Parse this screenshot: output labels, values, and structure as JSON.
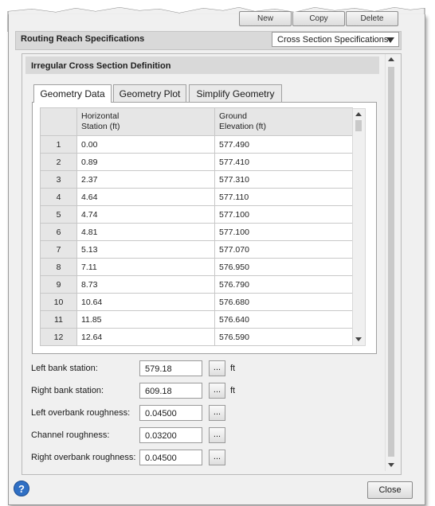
{
  "top_buttons": [
    "New",
    "Copy",
    "Delete"
  ],
  "reach": {
    "title": "Routing Reach Specifications",
    "dropdown_value": "Cross Section Specifications"
  },
  "section": {
    "title": "Irregular Cross Section Definition"
  },
  "tabs": [
    "Geometry Data",
    "Geometry Plot",
    "Simplify Geometry"
  ],
  "grid": {
    "col1": [
      "Horizontal",
      "Station (ft)"
    ],
    "col2": [
      "Ground",
      "Elevation (ft)"
    ],
    "rows": [
      {
        "n": "1",
        "station": "0.00",
        "elev": "577.490"
      },
      {
        "n": "2",
        "station": "0.89",
        "elev": "577.410"
      },
      {
        "n": "3",
        "station": "2.37",
        "elev": "577.310"
      },
      {
        "n": "4",
        "station": "4.64",
        "elev": "577.110"
      },
      {
        "n": "5",
        "station": "4.74",
        "elev": "577.100"
      },
      {
        "n": "6",
        "station": "4.81",
        "elev": "577.100"
      },
      {
        "n": "7",
        "station": "5.13",
        "elev": "577.070"
      },
      {
        "n": "8",
        "station": "7.11",
        "elev": "576.950"
      },
      {
        "n": "9",
        "station": "8.73",
        "elev": "576.790"
      },
      {
        "n": "10",
        "station": "10.64",
        "elev": "576.680"
      },
      {
        "n": "11",
        "station": "11.85",
        "elev": "576.640"
      },
      {
        "n": "12",
        "station": "12.64",
        "elev": "576.590"
      }
    ]
  },
  "fields": [
    {
      "label": "Left bank station:",
      "value": "579.18",
      "unit": "ft"
    },
    {
      "label": "Right bank station:",
      "value": "609.18",
      "unit": "ft"
    },
    {
      "label": "Left overbank roughness:",
      "value": "0.04500",
      "unit": ""
    },
    {
      "label": "Channel roughness:",
      "value": "0.03200",
      "unit": ""
    },
    {
      "label": "Right overbank roughness:",
      "value": "0.04500",
      "unit": ""
    }
  ],
  "ellipsis": "...",
  "help_glyph": "?",
  "close_label": "Close"
}
